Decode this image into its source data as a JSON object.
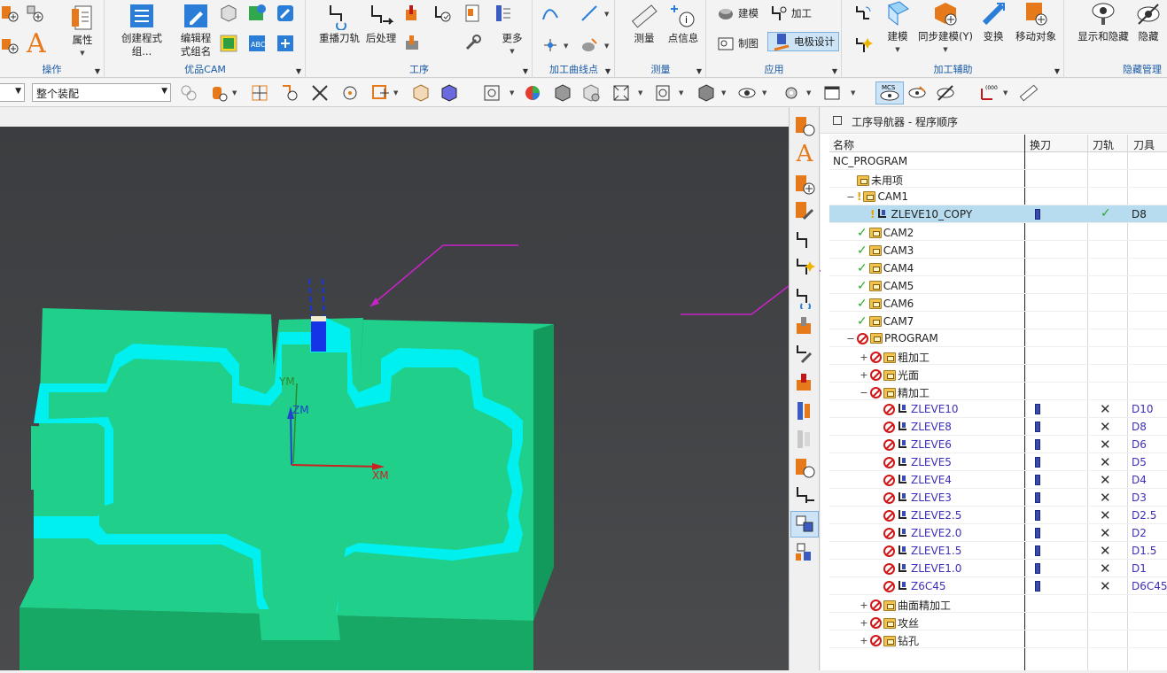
{
  "ribbon": {
    "groups": [
      {
        "label": "操作"
      },
      {
        "label": "优品CAM"
      },
      {
        "label": "工序"
      },
      {
        "label": "加工曲线点"
      },
      {
        "label": "测量"
      },
      {
        "label": "应用"
      },
      {
        "label": "加工辅助"
      },
      {
        "label": "隐藏管理"
      }
    ],
    "buttons": {
      "attributes": "属性",
      "create_program_group": "创建程式组...",
      "edit_program_group_1": "编辑程",
      "edit_program_group_2": "式组名",
      "regenerate_toolpath": "重播刀轨",
      "postprocess": "后处理",
      "more": "更多",
      "measure": "测量",
      "point_info": "点信息",
      "build_model": "建模",
      "machining": "加工",
      "drawing": "制图",
      "electrode_design": "电极设计",
      "modeling": "建模",
      "sync_modeling": "同步建模(Y)",
      "transform": "变换",
      "move_object": "移动对象",
      "show_hide": "显示和隐藏",
      "hide": "隐藏"
    }
  },
  "toolbar2": {
    "selection_filter": "",
    "assembly_scope": "整个装配"
  },
  "viewport": {
    "axes": {
      "ym": "YM",
      "zm": "ZM",
      "xm": "XM"
    },
    "colors": {
      "part_face": "#1fcf8a",
      "wall": "#00f0f0",
      "side": "#18a866",
      "annotation": "#c823c8"
    }
  },
  "navigator": {
    "title": "工序导航器 - 程序顺序",
    "columns": [
      "名称",
      "换刀",
      "刀轨",
      "刀具"
    ],
    "rows": [
      {
        "name": "NC_PROGRAM",
        "indent": 0,
        "expander": "",
        "status": "",
        "icon": "",
        "toolchange": "",
        "path": "",
        "tool": ""
      },
      {
        "name": "未用项",
        "indent": 1,
        "expander": "",
        "status": "",
        "icon": "folder",
        "toolchange": "",
        "path": "",
        "tool": ""
      },
      {
        "name": "CAM1",
        "indent": 1,
        "expander": "−",
        "status": "!",
        "icon": "folder",
        "toolchange": "",
        "path": "",
        "tool": ""
      },
      {
        "name": "ZLEVE10_COPY",
        "indent": 2,
        "expander": "",
        "status": "!",
        "icon": "op",
        "toolchange": "tool",
        "path": "✓",
        "tool": "D8",
        "selected": true
      },
      {
        "name": "CAM2",
        "indent": 1,
        "expander": "",
        "status": "✓",
        "icon": "folder",
        "toolchange": "",
        "path": "",
        "tool": ""
      },
      {
        "name": "CAM3",
        "indent": 1,
        "expander": "",
        "status": "✓",
        "icon": "folder",
        "toolchange": "",
        "path": "",
        "tool": ""
      },
      {
        "name": "CAM4",
        "indent": 1,
        "expander": "",
        "status": "✓",
        "icon": "folder",
        "toolchange": "",
        "path": "",
        "tool": ""
      },
      {
        "name": "CAM5",
        "indent": 1,
        "expander": "",
        "status": "✓",
        "icon": "folder",
        "toolchange": "",
        "path": "",
        "tool": ""
      },
      {
        "name": "CAM6",
        "indent": 1,
        "expander": "",
        "status": "✓",
        "icon": "folder",
        "toolchange": "",
        "path": "",
        "tool": ""
      },
      {
        "name": "CAM7",
        "indent": 1,
        "expander": "",
        "status": "✓",
        "icon": "folder",
        "toolchange": "",
        "path": "",
        "tool": ""
      },
      {
        "name": "PROGRAM",
        "indent": 1,
        "expander": "−",
        "status": "no",
        "icon": "folder",
        "toolchange": "",
        "path": "",
        "tool": ""
      },
      {
        "name": "粗加工",
        "indent": 2,
        "expander": "+",
        "status": "no",
        "icon": "folder",
        "toolchange": "",
        "path": "",
        "tool": ""
      },
      {
        "name": "光面",
        "indent": 2,
        "expander": "+",
        "status": "no",
        "icon": "folder",
        "toolchange": "",
        "path": "",
        "tool": ""
      },
      {
        "name": "精加工",
        "indent": 2,
        "expander": "−",
        "status": "no",
        "icon": "folder",
        "toolchange": "",
        "path": "",
        "tool": ""
      },
      {
        "name": "ZLEVE10",
        "indent": 3,
        "expander": "",
        "status": "no",
        "icon": "op",
        "toolchange": "tool",
        "path": "✕",
        "tool": "D10",
        "blue": true
      },
      {
        "name": "ZLEVE8",
        "indent": 3,
        "expander": "",
        "status": "no",
        "icon": "op",
        "toolchange": "tool",
        "path": "✕",
        "tool": "D8",
        "blue": true
      },
      {
        "name": "ZLEVE6",
        "indent": 3,
        "expander": "",
        "status": "no",
        "icon": "op",
        "toolchange": "tool",
        "path": "✕",
        "tool": "D6",
        "blue": true
      },
      {
        "name": "ZLEVE5",
        "indent": 3,
        "expander": "",
        "status": "no",
        "icon": "op",
        "toolchange": "tool",
        "path": "✕",
        "tool": "D5",
        "blue": true
      },
      {
        "name": "ZLEVE4",
        "indent": 3,
        "expander": "",
        "status": "no",
        "icon": "op",
        "toolchange": "tool",
        "path": "✕",
        "tool": "D4",
        "blue": true
      },
      {
        "name": "ZLEVE3",
        "indent": 3,
        "expander": "",
        "status": "no",
        "icon": "op",
        "toolchange": "tool",
        "path": "✕",
        "tool": "D3",
        "blue": true
      },
      {
        "name": "ZLEVE2.5",
        "indent": 3,
        "expander": "",
        "status": "no",
        "icon": "op",
        "toolchange": "tool",
        "path": "✕",
        "tool": "D2.5",
        "blue": true
      },
      {
        "name": "ZLEVE2.0",
        "indent": 3,
        "expander": "",
        "status": "no",
        "icon": "op",
        "toolchange": "tool",
        "path": "✕",
        "tool": "D2",
        "blue": true
      },
      {
        "name": "ZLEVE1.5",
        "indent": 3,
        "expander": "",
        "status": "no",
        "icon": "op",
        "toolchange": "tool",
        "path": "✕",
        "tool": "D1.5",
        "blue": true
      },
      {
        "name": "ZLEVE1.0",
        "indent": 3,
        "expander": "",
        "status": "no",
        "icon": "op",
        "toolchange": "tool",
        "path": "✕",
        "tool": "D1",
        "blue": true
      },
      {
        "name": "Z6C45",
        "indent": 3,
        "expander": "",
        "status": "no",
        "icon": "op",
        "toolchange": "tool",
        "path": "✕",
        "tool": "D6C45",
        "blue": true
      },
      {
        "name": "曲面精加工",
        "indent": 2,
        "expander": "+",
        "status": "no",
        "icon": "folder",
        "toolchange": "",
        "path": "",
        "tool": ""
      },
      {
        "name": "攻丝",
        "indent": 2,
        "expander": "+",
        "status": "no",
        "icon": "folder",
        "toolchange": "",
        "path": "",
        "tool": ""
      },
      {
        "name": "钻孔",
        "indent": 2,
        "expander": "+",
        "status": "no",
        "icon": "folder",
        "toolchange": "",
        "path": "",
        "tool": ""
      }
    ]
  }
}
